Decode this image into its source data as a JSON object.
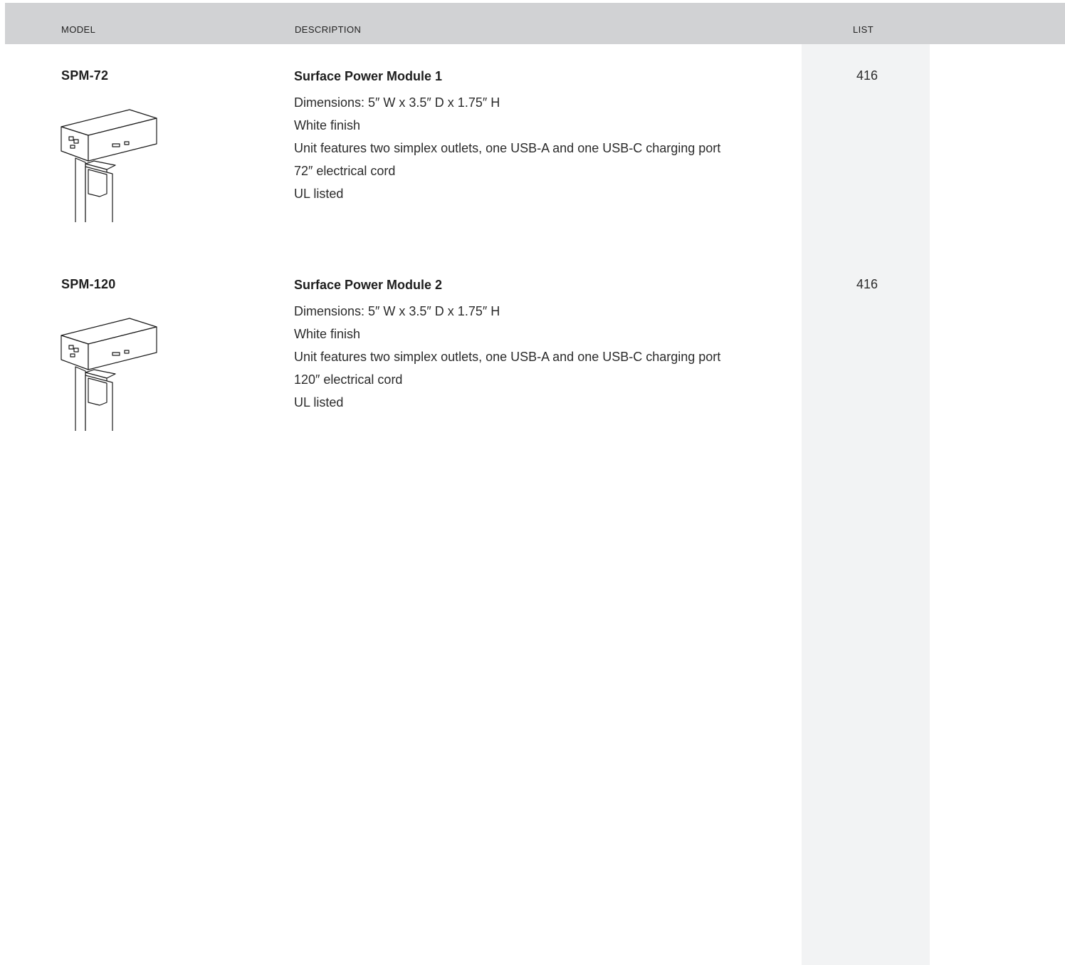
{
  "header": {
    "model_label": "MODEL",
    "description_label": "DESCRIPTION",
    "list_label": "LIST"
  },
  "products": [
    {
      "model": "SPM-72",
      "title": "Surface Power Module 1",
      "lines": [
        "Dimensions: 5″ W x 3.5″ D x 1.75″ H",
        "White finish",
        "Unit features two simplex outlets, one USB-A and one USB-C charging port",
        "72″ electrical cord",
        "UL listed"
      ],
      "price": "416"
    },
    {
      "model": "SPM-120",
      "title": "Surface Power Module 2",
      "lines": [
        "Dimensions: 5″ W x 3.5″ D x 1.75″ H",
        "White finish",
        "Unit features two simplex outlets, one USB-A and one USB-C charging port",
        "120″ electrical cord",
        "UL listed"
      ],
      "price": "416"
    }
  ],
  "colors": {
    "header_bg": "#d1d2d4",
    "list_column_bg": "#f2f3f4",
    "text": "#2b2b2b"
  }
}
